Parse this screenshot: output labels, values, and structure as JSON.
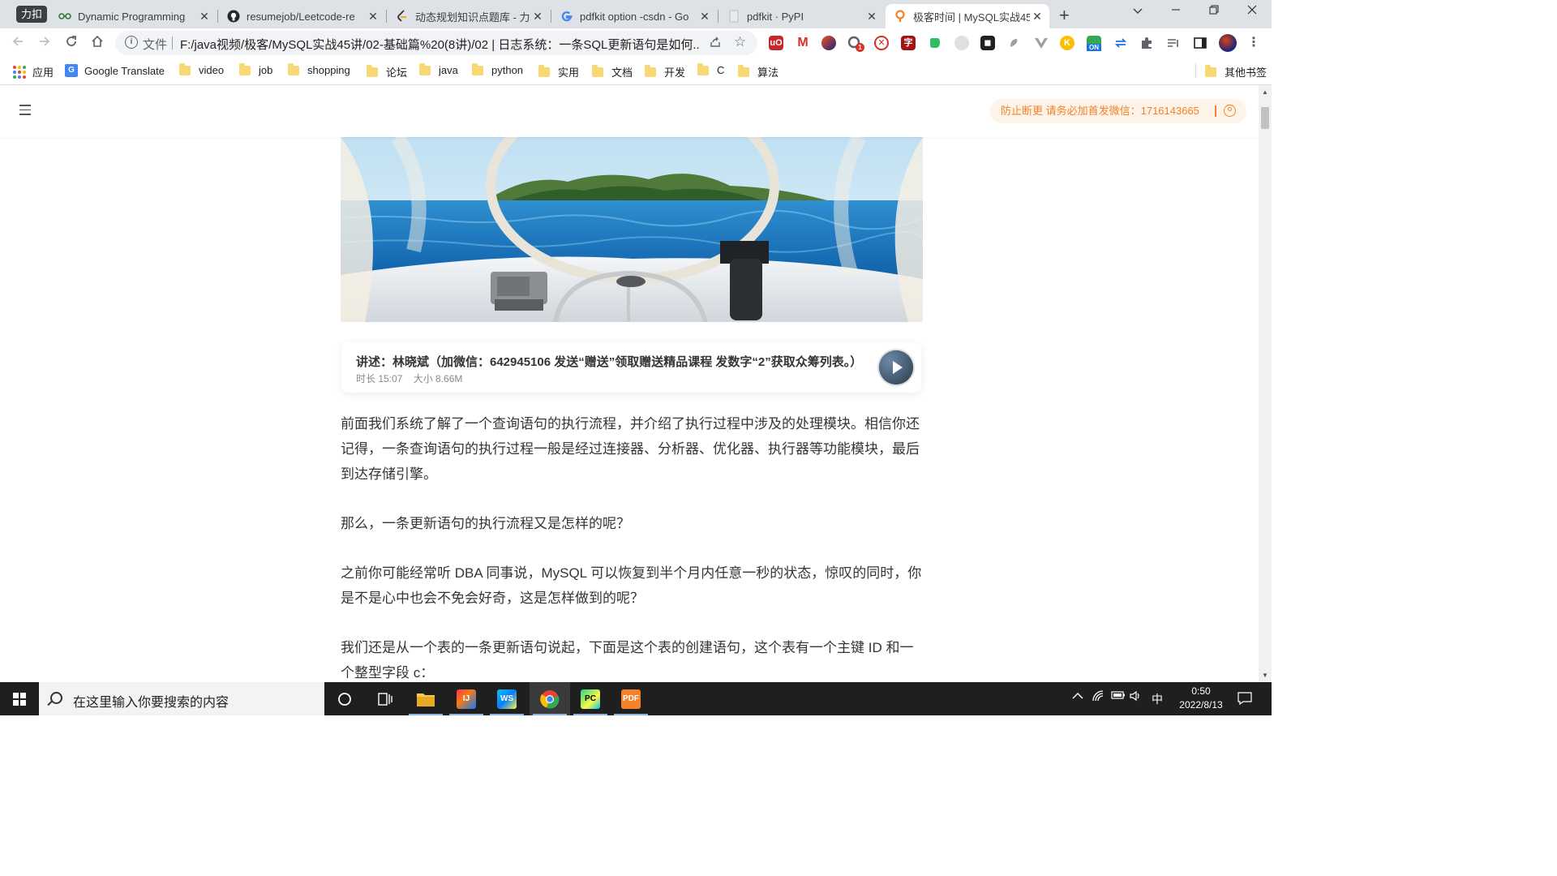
{
  "tabs": {
    "group_label": "力扣",
    "items": [
      {
        "title": "Dynamic Programming",
        "icon": "leetcode-icon"
      },
      {
        "title": "resumejob/Leetcode-re",
        "icon": "github-icon"
      },
      {
        "title": "动态规划知识点题库 - 力扣",
        "icon": "leetcode-icon"
      },
      {
        "title": "pdfkit option -csdn - Go",
        "icon": "google-icon"
      },
      {
        "title": "pdfkit · PyPI",
        "icon": "pypi-icon"
      },
      {
        "title": "极客时间 | MySQL实战45",
        "icon": "geektime-icon"
      }
    ],
    "new_tab": "+"
  },
  "address_bar": {
    "protocol_label": "文件",
    "url": "F:/java视频/极客/MySQL实战45讲/02-基础篇%20(8讲)/02 | 日志系统：一条SQL更新语句是如何..."
  },
  "extensions": {
    "badge_count": "1",
    "toggle_label": "ON"
  },
  "bookmarks": {
    "apps_label": "应用",
    "translate_label": "Google Translate",
    "folders": [
      "video",
      "job",
      "shopping",
      "论坛",
      "java",
      "python",
      "实用",
      "文档",
      "开发",
      "C",
      "算法"
    ],
    "other_label": "其他书签"
  },
  "page": {
    "notice": "防止断更 请务必加首发微信：1716143665",
    "audio": {
      "title": "讲述：林晓斌（加微信：642945106 发送“赠送”领取赠送精品课程 发数字“2”获取众筹列表。）",
      "duration": "时长 15:07",
      "size": "大小 8.66M"
    },
    "paragraphs": [
      "前面我们系统了解了一个查询语句的执行流程，并介绍了执行过程中涉及的处理模块。相信你还记得，一条查询语句的执行过程一般是经过连接器、分析器、优化器、执行器等功能模块，最后到达存储引擎。",
      "那么，一条更新语句的执行流程又是怎样的呢？",
      "之前你可能经常听 DBA 同事说，MySQL 可以恢复到半个月内任意一秒的状态，惊叹的同时，你是不是心中也会不免会好奇，这是怎样做到的呢？",
      "我们还是从一个表的一条更新语句说起，下面是这个表的创建语句，这个表有一个主键 ID 和一个整型字段 c："
    ]
  },
  "taskbar": {
    "search_placeholder": "在这里输入你要搜索的内容",
    "ime": "中",
    "time": "0:50",
    "date": "2022/8/13"
  }
}
